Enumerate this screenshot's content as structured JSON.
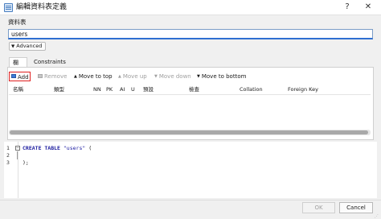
{
  "window": {
    "title": "編輯資料表定義",
    "help": "?",
    "close": "✕"
  },
  "form": {
    "table_name_label": "資料表",
    "table_name_value": "users",
    "advanced_label": "Advanced"
  },
  "tabs": [
    {
      "label": "欄位"
    },
    {
      "label": "Constraints"
    }
  ],
  "toolbar": {
    "add": "Add",
    "remove": "Remove",
    "move_top": "Move to top",
    "move_up": "Move up",
    "move_down": "Move down",
    "move_bottom": "Move to bottom"
  },
  "columns": {
    "headers": [
      "名稱",
      "類型",
      "NN",
      "PK",
      "AI",
      "U",
      "預設",
      "檢查",
      "Collation",
      "Foreign Key"
    ]
  },
  "sql": {
    "line_numbers": [
      "1",
      "2",
      "3"
    ],
    "line1_keyword": "CREATE TABLE",
    "line1_string": "\"users\"",
    "line1_paren": " (",
    "line3": ");"
  },
  "footer": {
    "ok_label": "OK",
    "cancel_label": "Cancel"
  },
  "colors": {
    "accent": "#2f6fd1",
    "highlight_border": "#e02020",
    "sql_keyword": "#1a1a9e"
  }
}
